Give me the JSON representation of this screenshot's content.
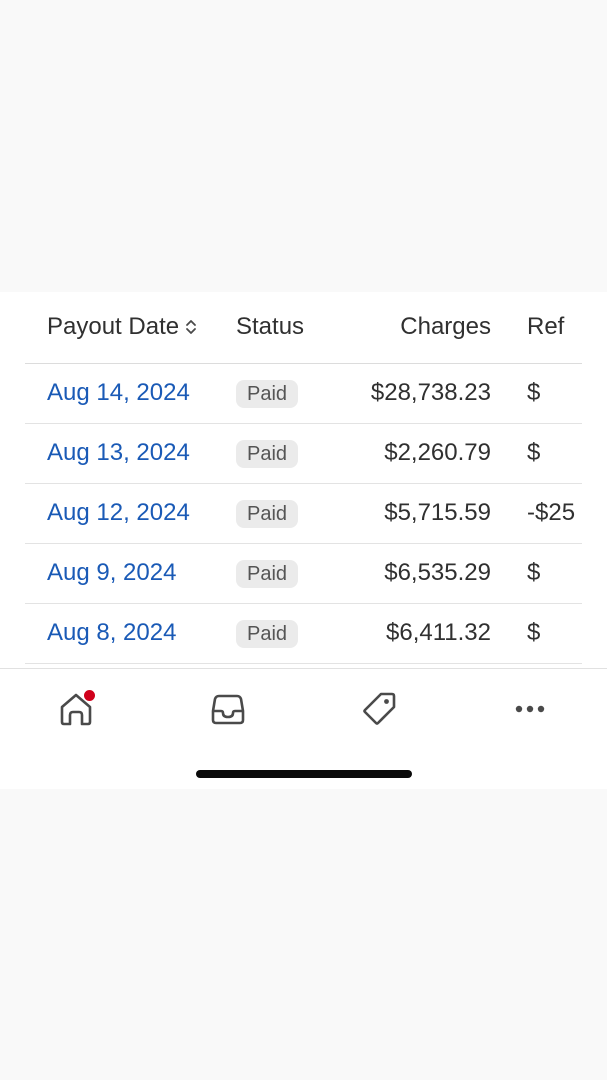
{
  "table": {
    "headers": {
      "payout_date": "Payout Date",
      "status": "Status",
      "charges": "Charges",
      "refunds": "Ref"
    },
    "rows": [
      {
        "date": "Aug 14, 2024",
        "status": "Paid",
        "charges": "$28,738.23",
        "refunds": "$"
      },
      {
        "date": "Aug 13, 2024",
        "status": "Paid",
        "charges": "$2,260.79",
        "refunds": "$"
      },
      {
        "date": "Aug 12, 2024",
        "status": "Paid",
        "charges": "$5,715.59",
        "refunds": "-$25"
      },
      {
        "date": "Aug 9, 2024",
        "status": "Paid",
        "charges": "$6,535.29",
        "refunds": "$"
      },
      {
        "date": "Aug 8, 2024",
        "status": "Paid",
        "charges": "$6,411.32",
        "refunds": "$"
      }
    ]
  },
  "tab_bar": {
    "tabs": [
      {
        "icon": "home-icon",
        "has_notification": true
      },
      {
        "icon": "inbox-icon",
        "has_notification": false
      },
      {
        "icon": "tag-icon",
        "has_notification": false
      },
      {
        "icon": "more-icon",
        "has_notification": false
      }
    ]
  },
  "colors": {
    "link": "#1a5ab6",
    "notification": "#d0001b",
    "badge_bg": "#ebebeb"
  }
}
